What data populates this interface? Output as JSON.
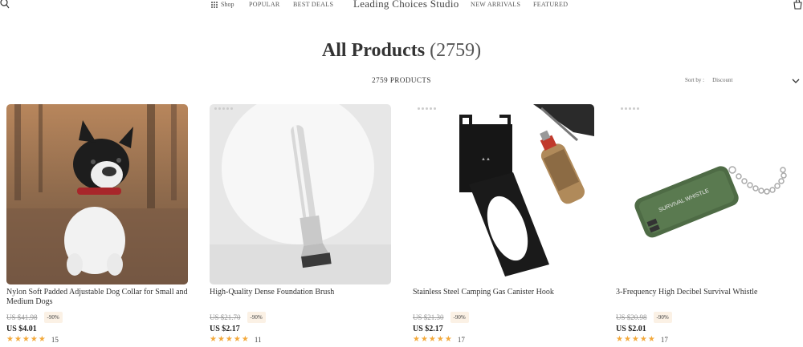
{
  "header": {
    "shop_label": "Shop",
    "nav_popular": "POPULAR",
    "nav_best_deals": "BEST DEALS",
    "brand": "Leading Choices Studio",
    "nav_new_arrivals": "NEW ARRIVALS",
    "nav_featured": "FEATURED"
  },
  "page": {
    "title": "All Products",
    "title_count": "(2759)",
    "products_count": "2759 PRODUCTS",
    "sort_label": "Sort by :",
    "sort_value": "Discount"
  },
  "products": [
    {
      "name": "Nylon Soft Padded Adjustable Dog Collar for Small and Medium Dogs",
      "old_price": "US $41.98",
      "discount": "-90%",
      "price": "US $4.01",
      "stars": "★★★★★",
      "reviews": "15"
    },
    {
      "name": "High-Quality Dense Foundation Brush",
      "old_price": "US $21.70",
      "discount": "-90%",
      "price": "US $2.17",
      "stars": "★★★★★",
      "reviews": "11"
    },
    {
      "name": "Stainless Steel Camping Gas Canister Hook",
      "old_price": "US $21.30",
      "discount": "-90%",
      "price": "US $2.17",
      "stars": "★★★★★",
      "reviews": "17"
    },
    {
      "name": "3-Frequency High Decibel Survival Whistle",
      "old_price": "US $20.98",
      "discount": "-90%",
      "price": "US $2.01",
      "stars": "★★★★★",
      "reviews": "17"
    }
  ],
  "images": {
    "whistle_text": "SURVIVAL WHISTLE"
  },
  "colors": {
    "star": "#f3a93b",
    "badge_bg": "#fbf1e5"
  }
}
